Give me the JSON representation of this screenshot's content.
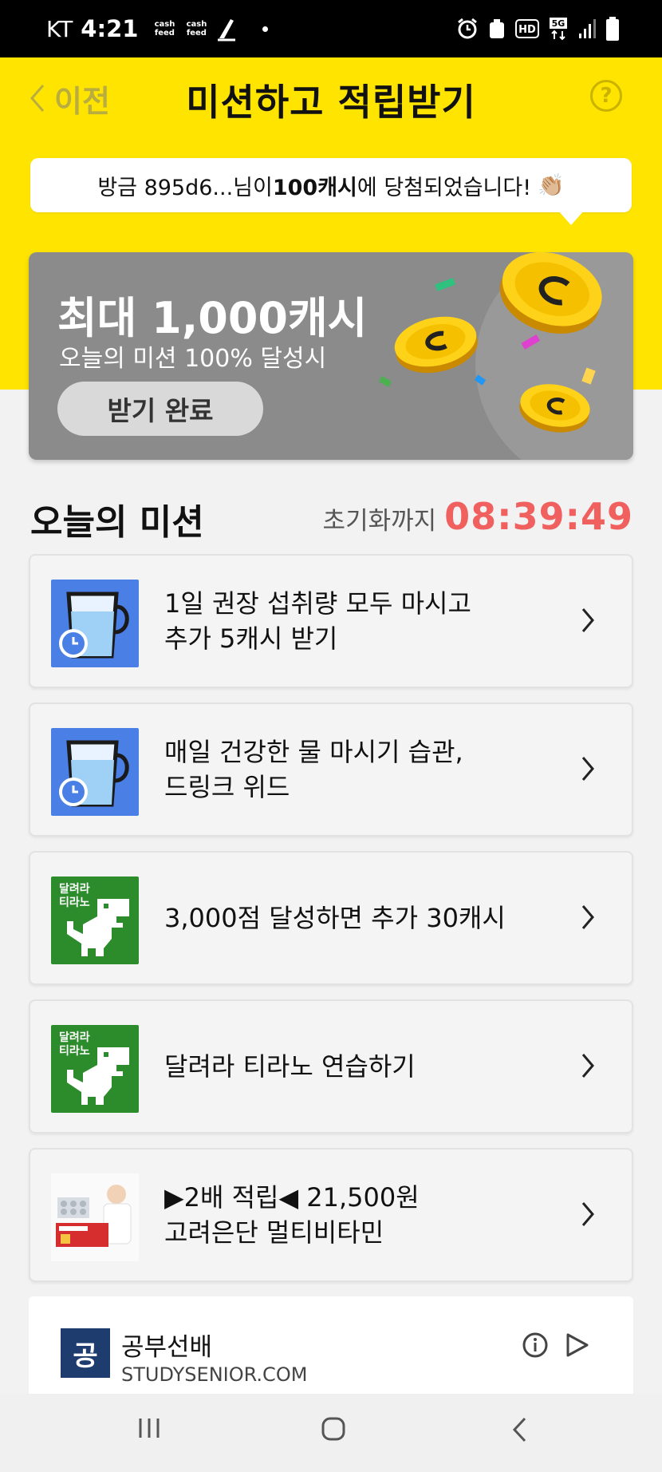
{
  "status_bar": {
    "carrier": "KT",
    "time": "4:21",
    "notif_icons": [
      "cash feed",
      "cash feed"
    ]
  },
  "header": {
    "back_label": "이전",
    "title": "미션하고 적립받기",
    "help": "?"
  },
  "notice": {
    "prefix": "방금 895d6...님이 ",
    "highlight": "100캐시",
    "suffix": "에 당첨되었습니다!",
    "emoji": "👏🏼"
  },
  "promo": {
    "title": "최대 1,000캐시",
    "subtitle": "오늘의 미션 100% 달성시",
    "button": "받기 완료"
  },
  "section": {
    "title": "오늘의 미션",
    "reset_label": "초기화까지",
    "reset_timer": "08:39:49"
  },
  "missions": [
    {
      "line1": "1일 권장 섭취량 모두 마시고",
      "line2": "추가 5캐시 받기"
    },
    {
      "line1": "매일 건강한 물 마시기 습관,",
      "line2": "드링크 위드"
    },
    {
      "line1": "3,000점 달성하면 추가 30캐시",
      "line2": "",
      "thumb_text": "달려라\n티라노"
    },
    {
      "line1": "달려라 티라노 연습하기",
      "line2": "",
      "thumb_text": "달려라\n티라노"
    },
    {
      "line1": "▶2배 적립◀ 21,500원",
      "line2": "고려은단 멀티비타민"
    }
  ],
  "ad": {
    "logo_char": "공",
    "name": "공부선배",
    "domain": "STUDYSENIOR.COM"
  },
  "colors": {
    "yellow": "#ffe400",
    "timer": "#f0605e",
    "water_blue": "#4a7fe6",
    "dino_green": "#2c8c2c"
  }
}
